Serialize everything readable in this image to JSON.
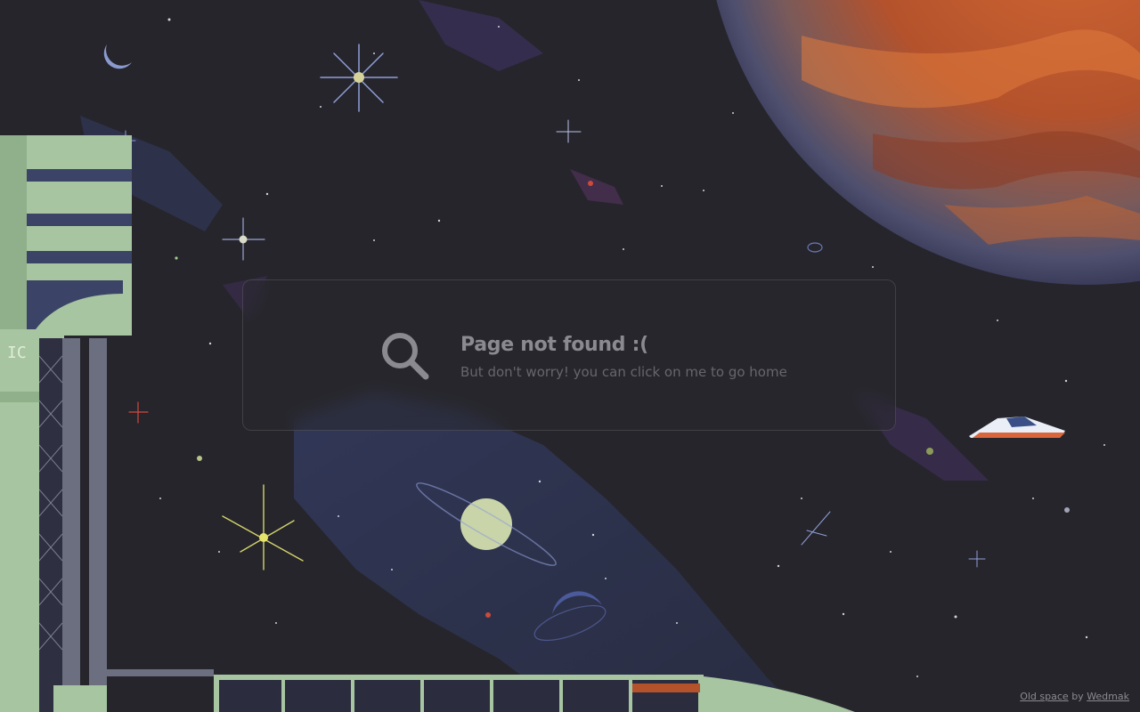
{
  "card": {
    "title": "Page not found :(",
    "subtitle": "But don't worry! you can click on me to go home",
    "icon": "search-icon"
  },
  "credit": {
    "artwork_link": "Old space",
    "by_text": "by",
    "author_link": "Wedmak"
  },
  "station": {
    "sign": "IC"
  },
  "colors": {
    "background": "#26252c",
    "planet_orange": "#c05a2a",
    "station_green": "#a9c7a0",
    "nebula_blue": "#3a4466",
    "card_text": "#8a8a90"
  }
}
